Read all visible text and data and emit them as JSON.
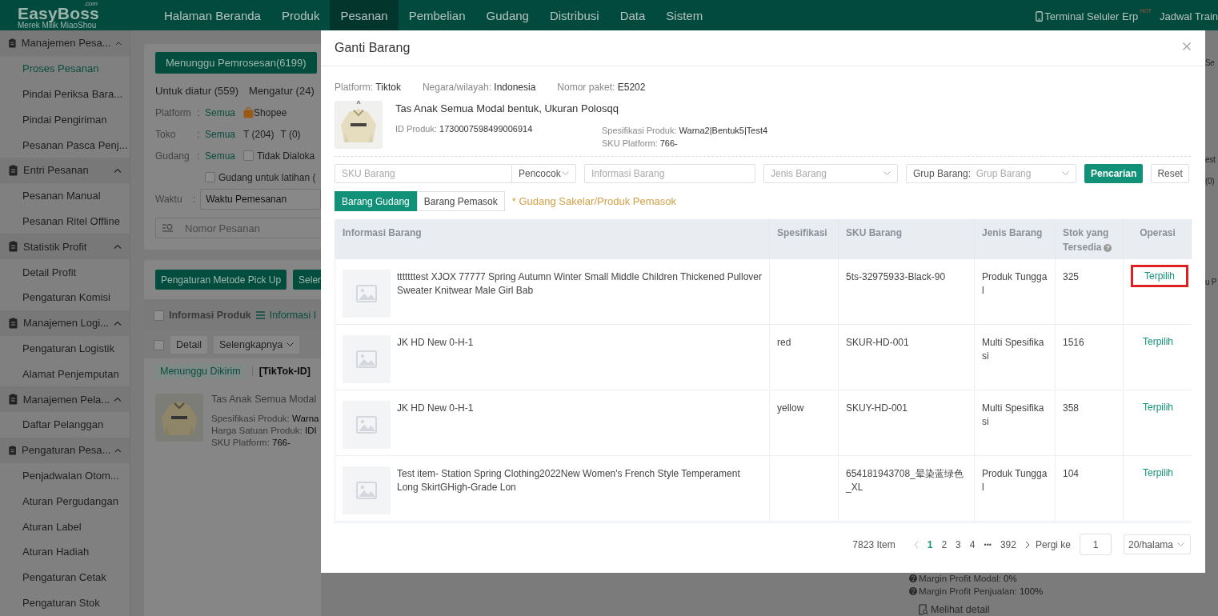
{
  "app": {
    "logo": "EasyBoss",
    "logo_suffix": ".com",
    "tagline": "Merek Milik MiaoShou"
  },
  "nav": [
    {
      "label": "Halaman Beranda",
      "selected": false
    },
    {
      "label": "Produk",
      "selected": false
    },
    {
      "label": "Pesanan",
      "selected": true
    },
    {
      "label": "Pembelian",
      "selected": false
    },
    {
      "label": "Gudang",
      "selected": false
    },
    {
      "label": "Distribusi",
      "selected": false
    },
    {
      "label": "Data",
      "selected": false
    },
    {
      "label": "Sistem",
      "selected": false
    }
  ],
  "top_right": {
    "mobile": "Terminal Seluler Erp",
    "badge": "HOT",
    "training": "Jadwal Train"
  },
  "sidebar": [
    {
      "label": "Manajemen Pesa...",
      "expanded": true,
      "children": [
        {
          "label": "Proses Pesanan",
          "selected": true
        },
        {
          "label": "Pindai Periksa Bara...",
          "selected": false
        },
        {
          "label": "Pindai Pengiriman",
          "selected": false
        },
        {
          "label": "Pesanan Pasca Penj...",
          "selected": false
        }
      ]
    },
    {
      "label": "Entri Pesanan",
      "expanded": true,
      "children": [
        {
          "label": "Pesanan Manual",
          "selected": false
        },
        {
          "label": "Pesanan Ritel Offline",
          "selected": false
        }
      ]
    },
    {
      "label": "Statistik Profit",
      "expanded": true,
      "children": [
        {
          "label": "Detail Profit",
          "selected": false
        },
        {
          "label": "Pengaturan Komisi",
          "selected": false
        }
      ]
    },
    {
      "label": "Manajemen Logi...",
      "expanded": true,
      "children": [
        {
          "label": "Pengaturan Logistik",
          "selected": false
        },
        {
          "label": "Alamat Penjemputan",
          "selected": false
        }
      ]
    },
    {
      "label": "Manajemen Pela...",
      "expanded": true,
      "children": [
        {
          "label": "Daftar Pelanggan",
          "selected": false
        }
      ]
    },
    {
      "label": "Pengaturan Pesa...",
      "expanded": true,
      "children": [
        {
          "label": "Penjadwalan Otom...",
          "selected": false
        },
        {
          "label": "Aturan Pergudangan",
          "selected": false
        },
        {
          "label": "Aturan Label",
          "selected": false
        },
        {
          "label": "Aturan Hadiah",
          "selected": false
        },
        {
          "label": "Pengaturan Cetak",
          "selected": false
        },
        {
          "label": "Pengaturan Stok",
          "selected": false
        }
      ]
    }
  ],
  "orders": {
    "status_tab": "Menunggu Pemrosesan(6199)",
    "sub_tabs": [
      "Untuk diatur (559)",
      "Mengatur (24)"
    ],
    "filters": [
      {
        "label": "Platform",
        "colon": ":",
        "value": "Semua",
        "options": [
          "Shopee"
        ]
      },
      {
        "label": "Toko",
        "colon": ":",
        "value": "Semua",
        "options": [
          "T (204)",
          "T (0)"
        ]
      },
      {
        "label": "Gudang",
        "colon": ":",
        "value": "Semua"
      }
    ],
    "unallocated": {
      "label": "Tidak Dialoka",
      "checked": false
    },
    "training": {
      "label": "Gudang untuk latihan (",
      "checked": false
    },
    "time": {
      "label": "Waktu",
      "colon": ":",
      "value": "Waktu Pemesanan"
    },
    "search": {
      "placeholder": "Nomor Pesanan"
    },
    "actions": [
      "Pengaturan Metode Pick Up",
      "Seler"
    ],
    "list_header": {
      "label": "Informasi Produk",
      "link": "Informasi I",
      "checked": false
    },
    "bulk": {
      "checked": false,
      "buttons": [
        "Detail",
        "Selengkapnya"
      ]
    },
    "order": {
      "status": "Menunggu Dikirim",
      "platform": "[TikTok-ID]",
      "title": "Tas Anak Semua Modal",
      "fields": [
        {
          "label": "Spesifikasi Produk:",
          "value": "Warna"
        },
        {
          "label": "Harga Satuan Produk:",
          "value": "IDI"
        },
        {
          "label": "SKU Platform:",
          "value": "766-"
        }
      ]
    },
    "right_fragments": [
      "Se",
      "est",
      "(0)",
      "u P"
    ],
    "profit": [
      {
        "label": "Margin Profit Modal:",
        "value": "0%"
      },
      {
        "label": "Margin Profit Penjualan:",
        "value": "100%"
      }
    ],
    "detail_link": "Melihat detail"
  },
  "dialog": {
    "title": "Ganti Barang",
    "info": [
      {
        "label": "Platform:",
        "value": "Tiktok"
      },
      {
        "label": "Negara/wilayah:",
        "value": "Indonesia"
      },
      {
        "label": "Nomor paket:",
        "value": "E5202"
      }
    ],
    "product": {
      "title": "Tas Anak Semua Modal bentuk, Ukuran Polosqq",
      "id_label": "ID Produk:",
      "id": "1730007598499006914",
      "spec_label": "Spesifikasi Produk:",
      "spec": "Warna2|Bentuk5|Test4",
      "sku_label": "SKU Platform:",
      "sku": "766-"
    },
    "filters": {
      "sku_placeholder": "SKU Barang",
      "match": "Pencocok",
      "info_placeholder": "Informasi Barang",
      "type_placeholder": "Jenis Barang",
      "group_label": "Grup Barang:",
      "group_placeholder": "Grup Barang",
      "search": "Pencarian",
      "reset": "Reset"
    },
    "sources": [
      {
        "label": "Barang Gudang",
        "selected": true
      },
      {
        "label": "Barang Pemasok",
        "selected": false
      }
    ],
    "hint": "* Gudang Sakelar/Produk Pemasok",
    "columns": [
      {
        "label": "Informasi Barang"
      },
      {
        "label": "Spesifikasi"
      },
      {
        "label": "SKU Barang"
      },
      {
        "label": "Jenis Barang"
      },
      {
        "label": "Stok yang Tersedia",
        "help": "?"
      },
      {
        "label": "Operasi"
      }
    ],
    "rows": [
      {
        "info": "tttttttest XJOX 77777 Spring Autumn Winter Small Middle Children Thickened Pullover Sweater Knitwear Male Girl Bab",
        "spec": "",
        "sku": "5ts-32975933-Black-90",
        "type": "Produk Tunggal",
        "stock": "325",
        "action": "Terpilih",
        "highlighted": true
      },
      {
        "info": "JK HD New 0-H-1",
        "spec": "red",
        "sku": "SKUR-HD-001",
        "type": "Multi Spesifikasi",
        "stock": "1516",
        "action": "Terpilih",
        "highlighted": false
      },
      {
        "info": "JK HD New 0-H-1",
        "spec": "yellow",
        "sku": "SKUY-HD-001",
        "type": "Multi Spesifikasi",
        "stock": "358",
        "action": "Terpilih",
        "highlighted": false
      },
      {
        "info": "Test item- Station Spring Clothing2022New Women's French Style Temperament Long SkirtGHigh-Grade Lon",
        "spec": "",
        "sku": "654181943708_晕染蓝绿色_XL",
        "type": "Produk Tunggal",
        "stock": "104",
        "action": "Terpilih",
        "highlighted": false
      }
    ],
    "pagination": {
      "total": "7823 Item",
      "pages": [
        {
          "label": "1",
          "selected": true
        },
        {
          "label": "2",
          "selected": false
        },
        {
          "label": "3",
          "selected": false
        },
        {
          "label": "4",
          "selected": false
        }
      ],
      "ellipsis": "•••",
      "last": "392",
      "goto_label": "Pergi ke",
      "goto_value": "1",
      "page_size": "20/halama"
    }
  }
}
